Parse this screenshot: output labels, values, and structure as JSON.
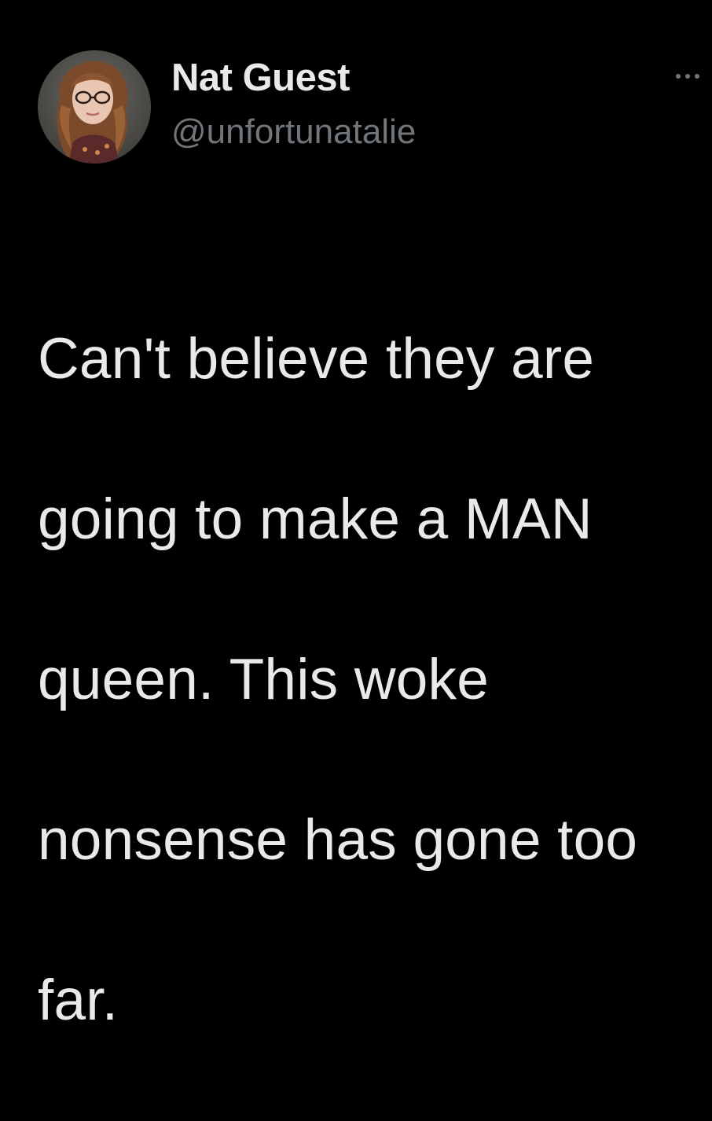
{
  "tweet": {
    "author": {
      "display_name": "Nat Guest",
      "handle": "@unfortunatalie",
      "avatar_icon": "profile-photo"
    },
    "more_icon": "more-options-icon",
    "text_lines": [
      "Can't believe they are",
      "going to make a MAN",
      "queen. This woke",
      "nonsense has gone too",
      "far."
    ]
  },
  "colors": {
    "background": "#000000",
    "primary_text": "#e7e9ea",
    "secondary_text": "#71767b"
  }
}
